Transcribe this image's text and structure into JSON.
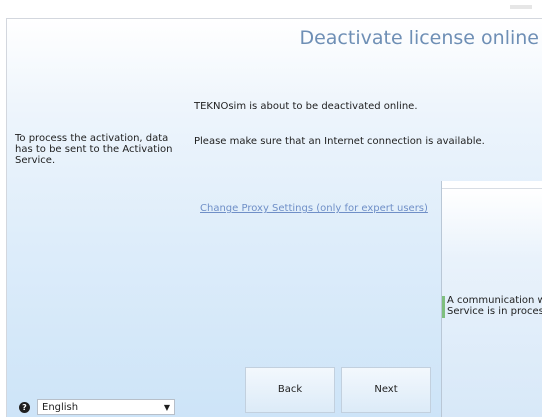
{
  "dialog": {
    "title": "Deactivate license online",
    "side_text": "To process the activation, data has to be sent to the Activation Service.",
    "message_line1": "TEKNOsim is about to be deactivated online.",
    "message_line2": "Please make sure that an Internet connection is available.",
    "proxy_link": "Change Proxy Settings (only for expert users)"
  },
  "overlay": {
    "text": "A communication with\nService is in process."
  },
  "footer": {
    "language": "English",
    "back_label": "Back",
    "next_label": "Next"
  },
  "icons": {
    "help": "help-icon",
    "dropdown": "chevron-down-icon"
  }
}
